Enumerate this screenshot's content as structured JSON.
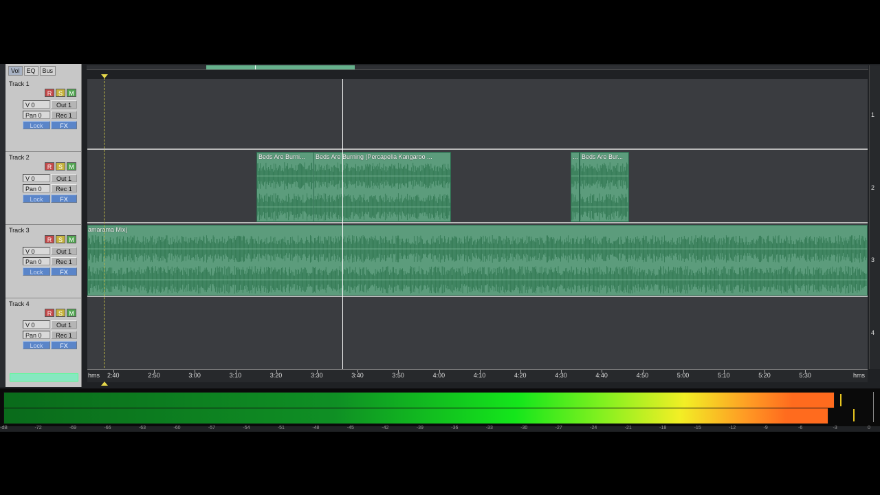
{
  "panel_tabs": [
    "Vol",
    "EQ",
    "Bus"
  ],
  "tracks": [
    {
      "name": "Track 1",
      "r": "R",
      "s": "S",
      "m": "M",
      "volume": "V 0",
      "pan": "Pan 0",
      "out": "Out 1",
      "rec": "Rec 1",
      "lock": "Lock",
      "fx": "FX",
      "number": "1"
    },
    {
      "name": "Track 2",
      "r": "R",
      "s": "S",
      "m": "M",
      "volume": "V 0",
      "pan": "Pan 0",
      "out": "Out 1",
      "rec": "Rec 1",
      "lock": "Lock",
      "fx": "FX",
      "number": "2"
    },
    {
      "name": "Track 3",
      "r": "R",
      "s": "S",
      "m": "M",
      "volume": "V 0",
      "pan": "Pan 0",
      "out": "Out 1",
      "rec": "Rec 1",
      "lock": "Lock",
      "fx": "FX",
      "number": "3"
    },
    {
      "name": "Track 4",
      "r": "R",
      "s": "S",
      "m": "M",
      "volume": "V 0",
      "pan": "Pan 0",
      "out": "Out 1",
      "rec": "Rec 1",
      "lock": "Lock",
      "fx": "FX",
      "number": "4"
    }
  ],
  "clips": {
    "t2a": "Beds Are Burni...",
    "t2b": "Beds Are Burning (Percapella Kangaroo ...",
    "t2c": "...",
    "t2d": "Beds Are Bur...",
    "t3": "amarama Mix)"
  },
  "timeline": {
    "unit_left": "hms",
    "unit_right": "hms",
    "ticks": [
      "2:40",
      "2:50",
      "3:00",
      "3:10",
      "3:20",
      "3:30",
      "3:40",
      "3:50",
      "4:00",
      "4:10",
      "4:20",
      "4:30",
      "4:40",
      "4:50",
      "5:00",
      "5:10",
      "5:20",
      "5:30"
    ]
  },
  "meter": {
    "scale": [
      "-dB",
      "-72",
      "-69",
      "-66",
      "-63",
      "-60",
      "-57",
      "-54",
      "-51",
      "-48",
      "-45",
      "-42",
      "-39",
      "-36",
      "-33",
      "-30",
      "-27",
      "-24",
      "-21",
      "-18",
      "-15",
      "-12",
      "-9",
      "-6",
      "-3",
      "0"
    ],
    "left_level_db": -3.0,
    "right_level_db": -3.5
  },
  "colors": {
    "clip": "#5c9c7c",
    "wave": "#2f7650",
    "cursor": "#ffffff",
    "start_marker": "#e6d84a"
  }
}
